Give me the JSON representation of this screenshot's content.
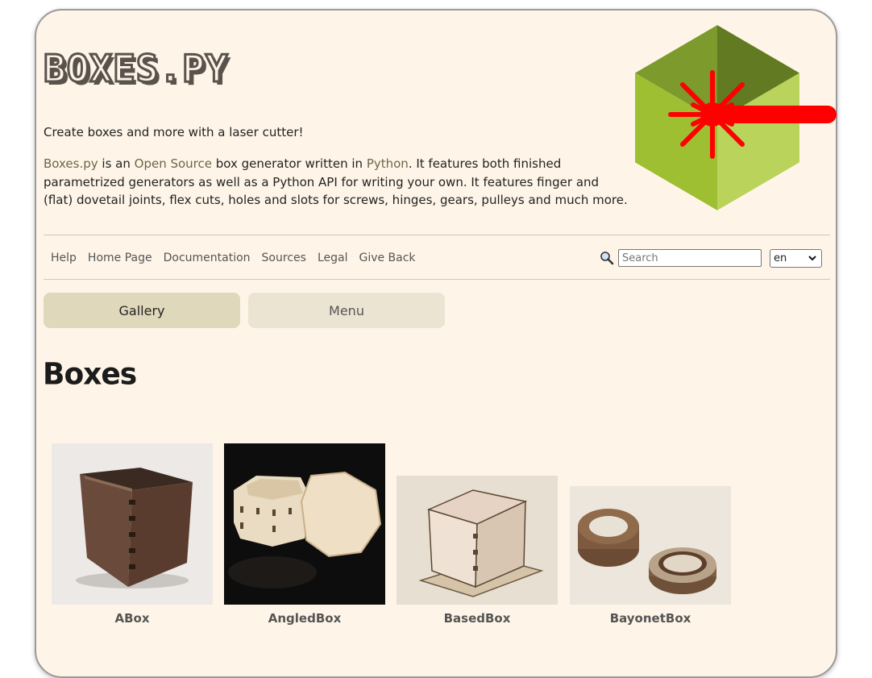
{
  "header": {
    "logo_text": "BOXES.PY",
    "tagline": "Create boxes and more with a laser cutter!",
    "intro": {
      "link_boxes": "Boxes.py",
      "t1": " is an ",
      "link_open_source": "Open Source",
      "t2": " box generator written in ",
      "link_python": "Python",
      "t3": ". It features both finished parametrized generators as well as a Python API for writing your own. It features finger and (flat) dovetail joints, flex cuts, holes and slots for screws, hinges, gears, pulleys and much more."
    }
  },
  "nav": {
    "items": [
      "Help",
      "Home Page",
      "Documentation",
      "Sources",
      "Legal",
      "Give Back"
    ]
  },
  "search": {
    "placeholder": "Search",
    "icon": "magnifier-icon"
  },
  "language": {
    "selected": "en"
  },
  "tabs": {
    "gallery": "Gallery",
    "menu": "Menu"
  },
  "section": {
    "title": "Boxes"
  },
  "gallery": [
    {
      "name": "ABox"
    },
    {
      "name": "AngledBox"
    },
    {
      "name": "BasedBox"
    },
    {
      "name": "BayonetBox"
    }
  ],
  "colors": {
    "page_bg": "#fef5e8",
    "link": "#6d6548",
    "tab_active": "#e0d8bb",
    "tab_inactive": "#ece4d3",
    "laser": "#ff0000"
  }
}
